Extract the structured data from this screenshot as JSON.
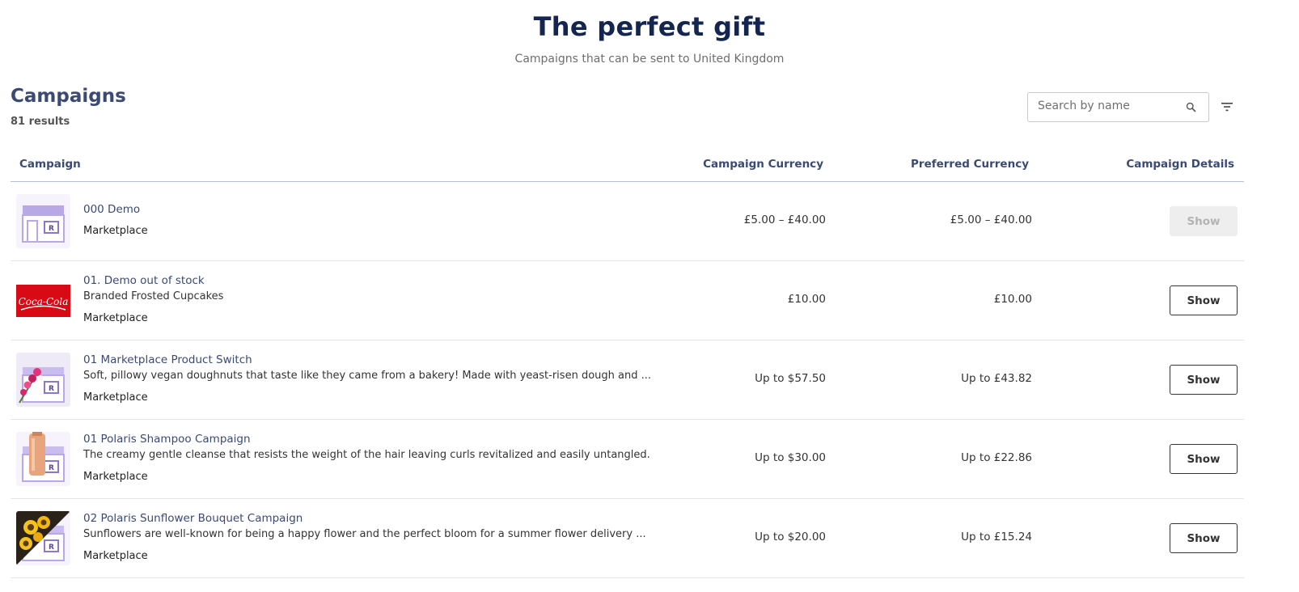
{
  "hero": {
    "title": "The perfect gift",
    "subtitle": "Campaigns that can be sent to United Kingdom"
  },
  "section": {
    "title": "Campaigns",
    "results": "81 results"
  },
  "search": {
    "placeholder": "Search by name",
    "value": ""
  },
  "table": {
    "headers": {
      "campaign": "Campaign",
      "campaign_currency": "Campaign Currency",
      "preferred_currency": "Preferred Currency",
      "details": "Campaign Details"
    },
    "rows": [
      {
        "name": "000 Demo",
        "description": "",
        "type": "Marketplace",
        "campaign_currency": "£5.00 – £40.00",
        "preferred_currency": "£5.00 – £40.00",
        "action": "Show",
        "action_disabled": true,
        "thumb": "store-icon"
      },
      {
        "name": "01. Demo out of stock",
        "description": "Branded Frosted Cupcakes",
        "type": "Marketplace",
        "campaign_currency": "£10.00",
        "preferred_currency": "£10.00",
        "action": "Show",
        "action_disabled": false,
        "thumb": "coca-cola-logo",
        "logo_text": "Coca-Cola"
      },
      {
        "name": "01 Marketplace Product Switch",
        "description": "Soft, pillowy vegan doughnuts that taste like they came from a bakery! Made with yeast-risen dough and ...",
        "type": "Marketplace",
        "campaign_currency": "Up to $57.50",
        "preferred_currency": "Up to £43.82",
        "action": "Show",
        "action_disabled": false,
        "thumb": "flowers-store-icon"
      },
      {
        "name": "01 Polaris Shampoo Campaign",
        "description": "The creamy gentle cleanse that resists the weight of the hair leaving curls revitalized and easily untangled.",
        "type": "Marketplace",
        "campaign_currency": "Up to $30.00",
        "preferred_currency": "Up to £22.86",
        "action": "Show",
        "action_disabled": false,
        "thumb": "shampoo-store-icon"
      },
      {
        "name": "02 Polaris Sunflower Bouquet Campaign",
        "description": "Sunflowers are well-known for being a happy flower and the perfect bloom for a summer flower delivery ...",
        "type": "Marketplace",
        "campaign_currency": "Up to $20.00",
        "preferred_currency": "Up to £15.24",
        "action": "Show",
        "action_disabled": false,
        "thumb": "sunflower-store-icon"
      }
    ]
  },
  "colors": {
    "heading": "#14264f",
    "accent": "#3b4a73",
    "store_purple": "#b9a8e6"
  }
}
